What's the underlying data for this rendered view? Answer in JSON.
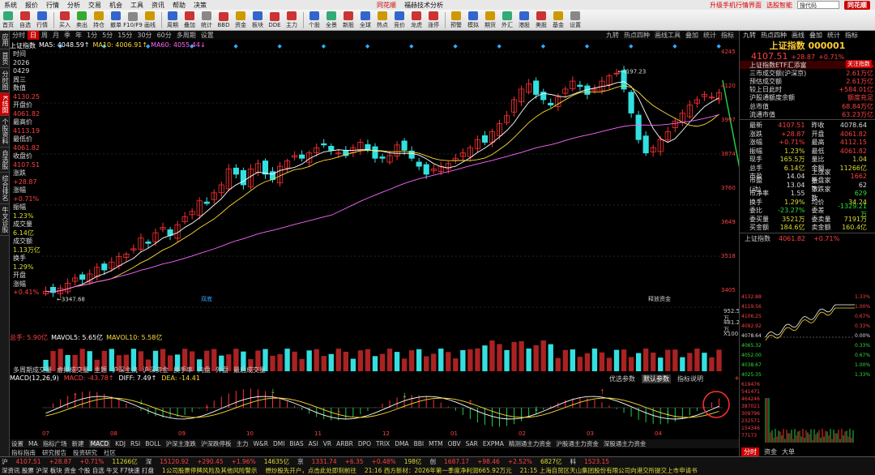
{
  "menubar": {
    "items": [
      "系统",
      "报价",
      "行情",
      "分析",
      "交易",
      "机会",
      "工具",
      "资讯",
      "帮助",
      "决策"
    ],
    "center": "同花顺",
    "center2": "福赫技术分析",
    "right_text": "升级手机行情界面",
    "right_text2": "选股智能",
    "search_placeholder": "搜代码",
    "brand": "同花顺"
  },
  "toolbar": {
    "buttons": [
      {
        "label": "首页",
        "color": "#3a7"
      },
      {
        "label": "自选",
        "color": "#c33"
      },
      {
        "label": "行情",
        "color": "#36c"
      },
      {
        "label": "买入",
        "color": "#c33"
      },
      {
        "label": "卖出",
        "color": "#3a3"
      },
      {
        "label": "持仓",
        "color": "#c90"
      },
      {
        "label": "撤单",
        "color": "#36c"
      },
      {
        "label": "F10/F9",
        "color": "#888"
      },
      {
        "label": "画线",
        "color": "#c90"
      },
      {
        "label": "周期",
        "color": "#36c"
      },
      {
        "label": "叠加",
        "color": "#c33"
      },
      {
        "label": "统计",
        "color": "#888"
      },
      {
        "label": "BBD",
        "color": "#c33"
      },
      {
        "label": "资金",
        "color": "#c90"
      },
      {
        "label": "板块",
        "color": "#36c"
      },
      {
        "label": "DDE",
        "color": "#c33"
      },
      {
        "label": "主力",
        "color": "#c33"
      },
      {
        "label": "个股",
        "color": "#36c"
      },
      {
        "label": "全景",
        "color": "#3a7"
      },
      {
        "label": "新股",
        "color": "#c33"
      },
      {
        "label": "全球",
        "color": "#36c"
      },
      {
        "label": "热点",
        "color": "#c90"
      },
      {
        "label": "竞价",
        "color": "#36c"
      },
      {
        "label": "龙虎",
        "color": "#c33"
      },
      {
        "label": "涨停",
        "color": "#c33"
      },
      {
        "label": "预警",
        "color": "#c90"
      },
      {
        "label": "模拟",
        "color": "#36c"
      },
      {
        "label": "期货",
        "color": "#c90"
      },
      {
        "label": "外汇",
        "color": "#3a7"
      },
      {
        "label": "港股",
        "color": "#36c"
      },
      {
        "label": "美股",
        "color": "#c33"
      },
      {
        "label": "基金",
        "color": "#c90"
      },
      {
        "label": "设置",
        "color": "#888"
      }
    ]
  },
  "leftbar": {
    "tabs": [
      "应用",
      "首页",
      "分时图",
      "K线图",
      "个股资料",
      "自选股",
      "综合排名",
      "牛叉诊股"
    ]
  },
  "tabs": {
    "items": [
      "分时",
      "日",
      "周",
      "月",
      "季",
      "年",
      "1分",
      "5分",
      "15分",
      "30分",
      "60分",
      "多周期",
      "设置"
    ],
    "active": "日",
    "right": [
      "九转",
      "热点四种",
      "画线工具",
      "叠加",
      "统计",
      "指标"
    ]
  },
  "chart_title": "上证指数",
  "ma_legend": [
    {
      "label": "MA5: 4048.59↑",
      "color": "#ffffff"
    },
    {
      "label": "MA10: 4006.91↑",
      "color": "#ffdd33"
    },
    {
      "label": "MA60: 4055.44↓",
      "color": "#ff66ff"
    }
  ],
  "info_col": [
    {
      "k": "时间",
      "v": "2026",
      "c": "w"
    },
    {
      "k": "",
      "v": "0429",
      "c": "w"
    },
    {
      "k": "",
      "v": "周三",
      "c": "w"
    },
    {
      "k": "数值",
      "v": "4130.25",
      "c": "r"
    },
    {
      "k": "开盘价",
      "v": "4061.82",
      "c": "r"
    },
    {
      "k": "最高价",
      "v": "4113.19",
      "c": "r"
    },
    {
      "k": "最低价",
      "v": "4061.82",
      "c": "r"
    },
    {
      "k": "收盘价",
      "v": "4107.51",
      "c": "r"
    },
    {
      "k": "涨跌",
      "v": "+28.87",
      "c": "r"
    },
    {
      "k": "涨幅",
      "v": "+0.71%",
      "c": "r"
    },
    {
      "k": "振幅",
      "v": "1.23%",
      "c": "y"
    },
    {
      "k": "成交量",
      "v": "6.14亿",
      "c": "y"
    },
    {
      "k": "成交额",
      "v": "1.13万亿",
      "c": "y"
    },
    {
      "k": "换手",
      "v": "1.29%",
      "c": "y"
    },
    {
      "k": "开盘",
      "v": "涨幅",
      "c": "w"
    },
    {
      "k": "",
      "v": "+0.41%",
      "c": "r"
    }
  ],
  "price_axis": [
    "4245",
    "4120",
    "3997",
    "3874",
    "3760",
    "3649",
    "3518",
    "3405"
  ],
  "main_labels": {
    "high": "4197.23",
    "low": "3347.68",
    "note1": "双底",
    "note2": "释放资金"
  },
  "chart_data": {
    "type": "candlestick",
    "title": "上证指数",
    "ylim": [
      3300,
      4260
    ],
    "high_marker": 4197.23,
    "low_marker": 3347.68,
    "closes": [
      3360,
      3355,
      3372,
      3390,
      3410,
      3405,
      3425,
      3450,
      3440,
      3470,
      3490,
      3500,
      3520,
      3560,
      3540,
      3580,
      3600,
      3570,
      3610,
      3640,
      3660,
      3700,
      3690,
      3730,
      3760,
      3820,
      3800,
      3760,
      3820,
      3840,
      3800,
      3780,
      3830,
      3850,
      3870,
      3860,
      3880,
      3900,
      3910,
      3890,
      3880,
      3870,
      3900,
      3920,
      3890,
      3860,
      3860,
      3870,
      3910,
      3890,
      3860,
      3830,
      3800,
      3820,
      3830,
      3840,
      3860,
      3880,
      3900,
      3930,
      3920,
      3960,
      3990,
      4020,
      4080,
      4120,
      4140,
      4100,
      4080,
      4060,
      4090,
      4120,
      4150,
      4130,
      4100,
      4120,
      4150,
      4170,
      4180,
      4120,
      4030,
      3930,
      3880,
      3900,
      3930,
      3960,
      4000,
      4030,
      4060,
      4080,
      4100,
      4090,
      4107
    ],
    "volume_x": "Volume",
    "macd": {
      "name": "MACD(12,26,9)",
      "diff": 7.49,
      "dea": -14.41,
      "macd": -43.78
    }
  },
  "vol_legend": [
    {
      "label": "总手: 5.90亿",
      "color": "#ff4040"
    },
    {
      "label": "MAVOL5: 5.65亿",
      "color": "#ffffff"
    },
    {
      "label": "MAVOL10: 5.58亿",
      "color": "#ffdd33"
    }
  ],
  "vol_axis": [
    "952.55万",
    "481.29万",
    "X100"
  ],
  "mid_tabs": [
    "多周期成交量",
    "虚拟成交量",
    "主题",
    "沪深主流",
    "沪深资金",
    "换手率",
    "内盘",
    "外盘",
    "最后成交量"
  ],
  "macd_legend": [
    {
      "label": "MACD(12,26,9)",
      "color": "#ffffff"
    },
    {
      "label": "MACD: -43.78↑",
      "color": "#ff4040"
    },
    {
      "label": "DIFF: 7.49↑",
      "color": "#ffffff"
    },
    {
      "label": "DEA: -14.41",
      "color": "#ffdd33"
    }
  ],
  "macd_right": [
    "优选参数",
    "默认参数",
    "指标说明"
  ],
  "macd_axis": [
    "+33.43"
  ],
  "dates": [
    "07",
    "08",
    "09",
    "10",
    "11",
    "12",
    "01",
    "02",
    "03",
    "04"
  ],
  "ind_tabs": [
    "设置",
    "MA",
    "指标广场",
    "新建",
    "MACD",
    "KDJ",
    "RSI",
    "BOLL",
    "沪深主涨跌",
    "沪深跌停板",
    "主力",
    "W&R",
    "DMI",
    "BIAS",
    "ASI",
    "VR",
    "ARBR",
    "DPO",
    "TRIX",
    "DMA",
    "BBI",
    "MTM",
    "OBV",
    "SAR",
    "EXPMA",
    "精测通主力资金",
    "沪股通主力资金",
    "深股通主力资金"
  ],
  "ind_active": "MACD",
  "bot_tabs": [
    "指标指南",
    "研究报告",
    "投资研究",
    "社区"
  ],
  "ticker": {
    "row1": [
      {
        "t": "沪",
        "c": "w"
      },
      {
        "t": "4107.51",
        "c": "r"
      },
      {
        "t": "+28.87",
        "c": "r"
      },
      {
        "t": "+0.71%",
        "c": "r"
      },
      {
        "t": "11266亿",
        "c": "y"
      },
      {
        "t": "深",
        "c": "w"
      },
      {
        "t": "15120.92",
        "c": "r"
      },
      {
        "t": "+290.45",
        "c": "r"
      },
      {
        "t": "+1.96%",
        "c": "r"
      },
      {
        "t": "14635亿",
        "c": "y"
      },
      {
        "t": "京",
        "c": "w"
      },
      {
        "t": "1331.74",
        "c": "r"
      },
      {
        "t": "+6.35",
        "c": "r"
      },
      {
        "t": "+0.48%",
        "c": "r"
      },
      {
        "t": "198亿",
        "c": "y"
      },
      {
        "t": "创",
        "c": "w"
      },
      {
        "t": "1687.17",
        "c": "r"
      },
      {
        "t": "+98.46",
        "c": "r"
      },
      {
        "t": "+2.52%",
        "c": "r"
      },
      {
        "t": "6827亿",
        "c": "y"
      },
      {
        "t": "科",
        "c": "w"
      },
      {
        "t": "1523.15",
        "c": "r"
      }
    ],
    "row2": [
      {
        "t": "深资讯 股票 沪深 板块 资金 个股 自选 牛叉 F7快速 打盘",
        "c": "w"
      },
      {
        "t": "1公司股票停牌风险及其他风险警示",
        "c": "y"
      },
      {
        "t": "想炒股先开户，点击此处即刻前往",
        "c": "y"
      },
      {
        "t": "21:16 西方新材：2026年第一季度净利润665.92万元",
        "c": "y"
      },
      {
        "t": "21:15 上海自贸区天山集团股份有限公司向港交所提交上市申请书",
        "c": "y"
      }
    ]
  },
  "right": {
    "top_tabs": [
      "九转",
      "热点四种",
      "画线",
      "叠加",
      "统计",
      "指标"
    ],
    "title": "上证指数 000001",
    "price": "4107.51",
    "change": "+28.87",
    "pct": "+0.71%",
    "badge": "关注指数",
    "rows": [
      {
        "k": "上证指数ETF汇添富",
        "v": "+0.77%"
      },
      {
        "k": "三市成交额(沪深京)",
        "v": "2.61万亿"
      },
      {
        "k": "预估成交额",
        "v": "2.61万亿"
      },
      {
        "k": "较上日此时",
        "v": "+584.01亿"
      },
      {
        "k": "沪股通额度余额",
        "v": "额度充足"
      },
      {
        "k": "总市值",
        "v": "68.84万亿"
      },
      {
        "k": "流通市值",
        "v": "63.23万亿"
      }
    ],
    "quads": [
      [
        "最新",
        "4107.51",
        "昨收",
        "4078.64",
        "r",
        "w"
      ],
      [
        "涨跌",
        "+28.87",
        "开盘",
        "4061.82",
        "r",
        "r"
      ],
      [
        "涨幅",
        "+0.71%",
        "最高",
        "4112.15",
        "r",
        "r"
      ],
      [
        "振幅",
        "1.23%",
        "最低",
        "4061.82",
        "y",
        "r"
      ],
      [
        "现手",
        "165.5万",
        "量比",
        "1.04",
        "y",
        "y"
      ],
      [
        "总手",
        "6.14亿",
        "金额",
        "11266亿",
        "y",
        "y"
      ],
      [
        "市盈",
        "14.04",
        "上涨家数",
        "1662",
        "w",
        "r"
      ],
      [
        "市盈(动)",
        "13.04",
        "平盘家数",
        "62",
        "w",
        "w"
      ],
      [
        "市净率",
        "1.55",
        "下跌家数",
        "629",
        "w",
        "g"
      ],
      [
        "换手",
        "1.29%",
        "均价",
        "34.24",
        "y",
        "y"
      ],
      [
        "委比",
        "-23.27%",
        "委差",
        "-1329.21万",
        "g",
        "g"
      ],
      [
        "委买量",
        "3521万",
        "委卖量",
        "7191万",
        "y",
        "y"
      ],
      [
        "买金额",
        "184.6亿",
        "卖金额",
        "160.4亿",
        "y",
        "y"
      ]
    ],
    "mini_head": [
      "上证指数",
      "4061.82",
      "+0.71%"
    ],
    "mini_left_axis": [
      "4132.88",
      "4119.56",
      "4106.25",
      "4092.92",
      "4078.64",
      "4065.32",
      "4052.00",
      "4038.67",
      "4025.35"
    ],
    "mini_right_axis": [
      "1.33%",
      "1.00%",
      "0.67%",
      "0.33%",
      "0.00%",
      "0.33%",
      "0.67%",
      "1.00%",
      "1.33%"
    ],
    "mini_vol_axis": [
      "619476",
      "541471",
      "464246",
      "387021",
      "309796",
      "232571",
      "154346",
      "77173"
    ],
    "mini_tabs": [
      "分时",
      "资金",
      "大单"
    ],
    "mini_active": "分时"
  }
}
